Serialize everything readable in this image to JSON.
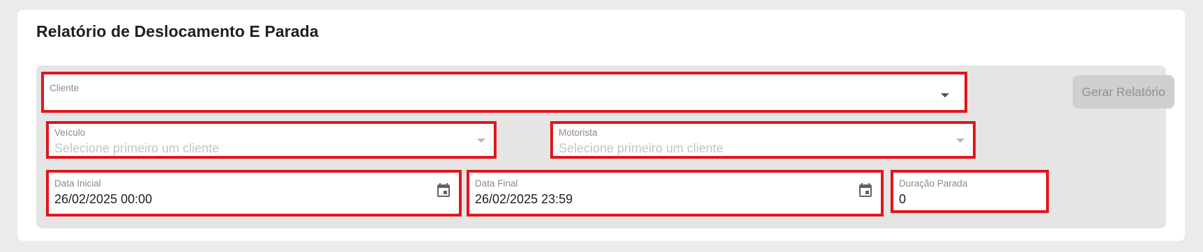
{
  "page": {
    "title": "Relatório de Deslocamento E Parada"
  },
  "form": {
    "cliente": {
      "label": "Cliente",
      "value": ""
    },
    "veiculo": {
      "label": "Veículo",
      "placeholder": "Selecione primeiro um cliente"
    },
    "motorista": {
      "label": "Motorista",
      "placeholder": "Selecione primeiro um cliente"
    },
    "data_inicial": {
      "label": "Data Inicial",
      "value": "26/02/2025 00:00"
    },
    "data_final": {
      "label": "Data Final",
      "value": "26/02/2025 23:59"
    },
    "duracao_parada": {
      "label": "Duração Parada",
      "value": "0"
    },
    "generate_button": {
      "label": "Gerar Relatório",
      "state": "disabled"
    }
  },
  "colors": {
    "highlight_border": "#e0161c",
    "background": "#ebebeb",
    "panel": "#e5e5e5",
    "button_disabled": "#cfcfcf"
  },
  "icons": {
    "dropdown": "chevron-down-icon",
    "date": "calendar-icon"
  }
}
